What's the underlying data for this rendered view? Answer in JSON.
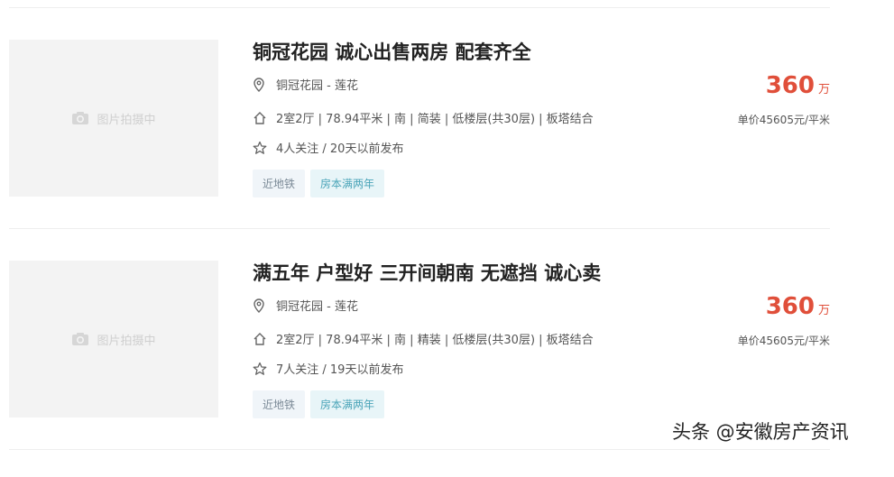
{
  "listings": [
    {
      "image_placeholder": "图片拍摄中",
      "title": "铜冠花园 诚心出售两房 配套齐全",
      "location": "铜冠花园 - 莲花",
      "details": "2室2厅 | 78.94平米 | 南 | 简装 | 低楼层(共30层) | 板塔结合",
      "follow": "4人关注 / 20天以前发布",
      "tags": [
        "近地铁",
        "房本满两年"
      ],
      "price": "360",
      "price_unit": "万",
      "unit_price": "单价45605元/平米"
    },
    {
      "image_placeholder": "图片拍摄中",
      "title": "满五年 户型好 三开间朝南 无遮挡 诚心卖",
      "location": "铜冠花园 - 莲花",
      "details": "2室2厅 | 78.94平米 | 南 | 精装 | 低楼层(共30层) | 板塔结合",
      "follow": "7人关注 / 19天以前发布",
      "tags": [
        "近地铁",
        "房本满两年"
      ],
      "price": "360",
      "price_unit": "万",
      "unit_price": "单价45605元/平米"
    }
  ],
  "watermark": "头条 @安徽房产资讯",
  "colors": {
    "price": "#e04f3a",
    "tag_fiveyear": "#4aa4b8",
    "tag_subway": "#7b8a97"
  }
}
